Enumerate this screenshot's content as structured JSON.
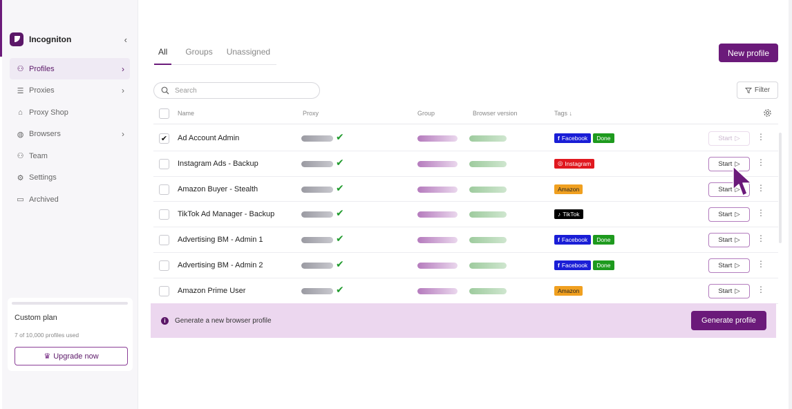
{
  "app": {
    "name": "Incogniton"
  },
  "sidebar": {
    "items": [
      {
        "label": "Profiles",
        "icon": "user-icon",
        "chevron": true,
        "active": true
      },
      {
        "label": "Proxies",
        "icon": "list-icon",
        "chevron": true
      },
      {
        "label": "Proxy Shop",
        "icon": "shop-icon",
        "chevron": false
      },
      {
        "label": "Browsers",
        "icon": "globe-icon",
        "chevron": true
      },
      {
        "label": "Team",
        "icon": "team-icon",
        "chevron": false
      },
      {
        "label": "Settings",
        "icon": "gear-icon",
        "chevron": false
      },
      {
        "label": "Archived",
        "icon": "archive-icon",
        "chevron": false
      }
    ],
    "plan": {
      "title": "Custom plan",
      "usage": "7 of 10,000 profiles used",
      "upgrade_label": "Upgrade now"
    }
  },
  "tabs": [
    {
      "label": "All",
      "active": true
    },
    {
      "label": "Groups",
      "active": false
    },
    {
      "label": "Unassigned",
      "active": false
    }
  ],
  "toolbar": {
    "new_profile_label": "New profile",
    "search_placeholder": "Search",
    "filter_label": "Filter"
  },
  "table": {
    "headers": {
      "name": "Name",
      "proxy": "Proxy",
      "group": "Group",
      "browser": "Browser version",
      "tags": "Tags ↓"
    },
    "rows": [
      {
        "name": "Ad Account Admin",
        "checked": true,
        "start_disabled": true,
        "tags": [
          {
            "label": "Facebook",
            "color": "#1a1ed6",
            "icon": "f"
          },
          {
            "label": "Done",
            "color": "#1e9a1e"
          }
        ]
      },
      {
        "name": "Instagram Ads - Backup",
        "checked": false,
        "start_disabled": false,
        "tags": [
          {
            "label": "Instagram",
            "color": "#e0181f",
            "icon": "◎"
          }
        ]
      },
      {
        "name": "Amazon Buyer - Stealth",
        "checked": false,
        "start_disabled": false,
        "tags": [
          {
            "label": "Amazon",
            "color": "#f0a020",
            "text_color": "#222"
          }
        ]
      },
      {
        "name": "TikTok Ad Manager - Backup",
        "checked": false,
        "start_disabled": false,
        "tags": [
          {
            "label": "TikTok",
            "color": "#000000",
            "icon": "♪"
          }
        ]
      },
      {
        "name": "Advertising BM - Admin 1",
        "checked": false,
        "start_disabled": false,
        "tags": [
          {
            "label": "Facebook",
            "color": "#1a1ed6",
            "icon": "f"
          },
          {
            "label": "Done",
            "color": "#1e9a1e"
          }
        ]
      },
      {
        "name": "Advertising BM - Admin 2",
        "checked": false,
        "start_disabled": false,
        "tags": [
          {
            "label": "Facebook",
            "color": "#1a1ed6",
            "icon": "f"
          },
          {
            "label": "Done",
            "color": "#1e9a1e"
          }
        ]
      },
      {
        "name": "Amazon Prime User",
        "checked": false,
        "start_disabled": false,
        "tags": [
          {
            "label": "Amazon",
            "color": "#f0a020",
            "text_color": "#222"
          }
        ]
      }
    ],
    "start_label": "Start"
  },
  "banner": {
    "text": "Generate a new browser profile",
    "button_label": "Generate profile"
  }
}
